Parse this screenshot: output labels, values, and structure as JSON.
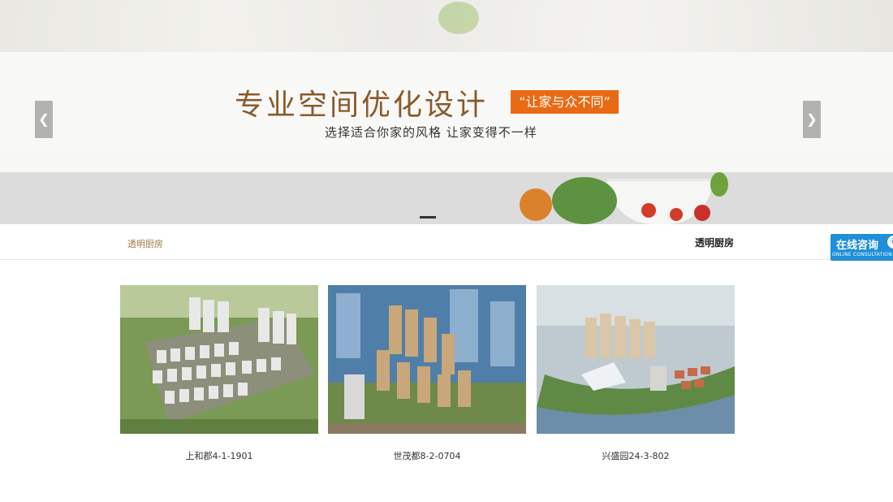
{
  "banner": {
    "title": "专业空间优化设计",
    "tag": "“让家与众不同”",
    "subtitle": "选择适合你家的风格  让家变得不一样",
    "prev_icon": "chevron-left-icon",
    "next_icon": "chevron-right-icon"
  },
  "category": {
    "left_label": "透明厨房",
    "right_label": "透明厨房"
  },
  "consult": {
    "title": "在线咨询",
    "subtitle": "ONLINE CONSULTATION",
    "icon": "phone-icon"
  },
  "projects": [
    {
      "name": "上和郡4-1-1901"
    },
    {
      "name": "世茂都8-2-0704"
    },
    {
      "name": "兴盛园24-3-802"
    }
  ],
  "colors": {
    "title": "#8a5a2b",
    "tag_bg": "#e96a14",
    "consult_bg": "#1e8fd8",
    "category_left": "#a0784a"
  }
}
